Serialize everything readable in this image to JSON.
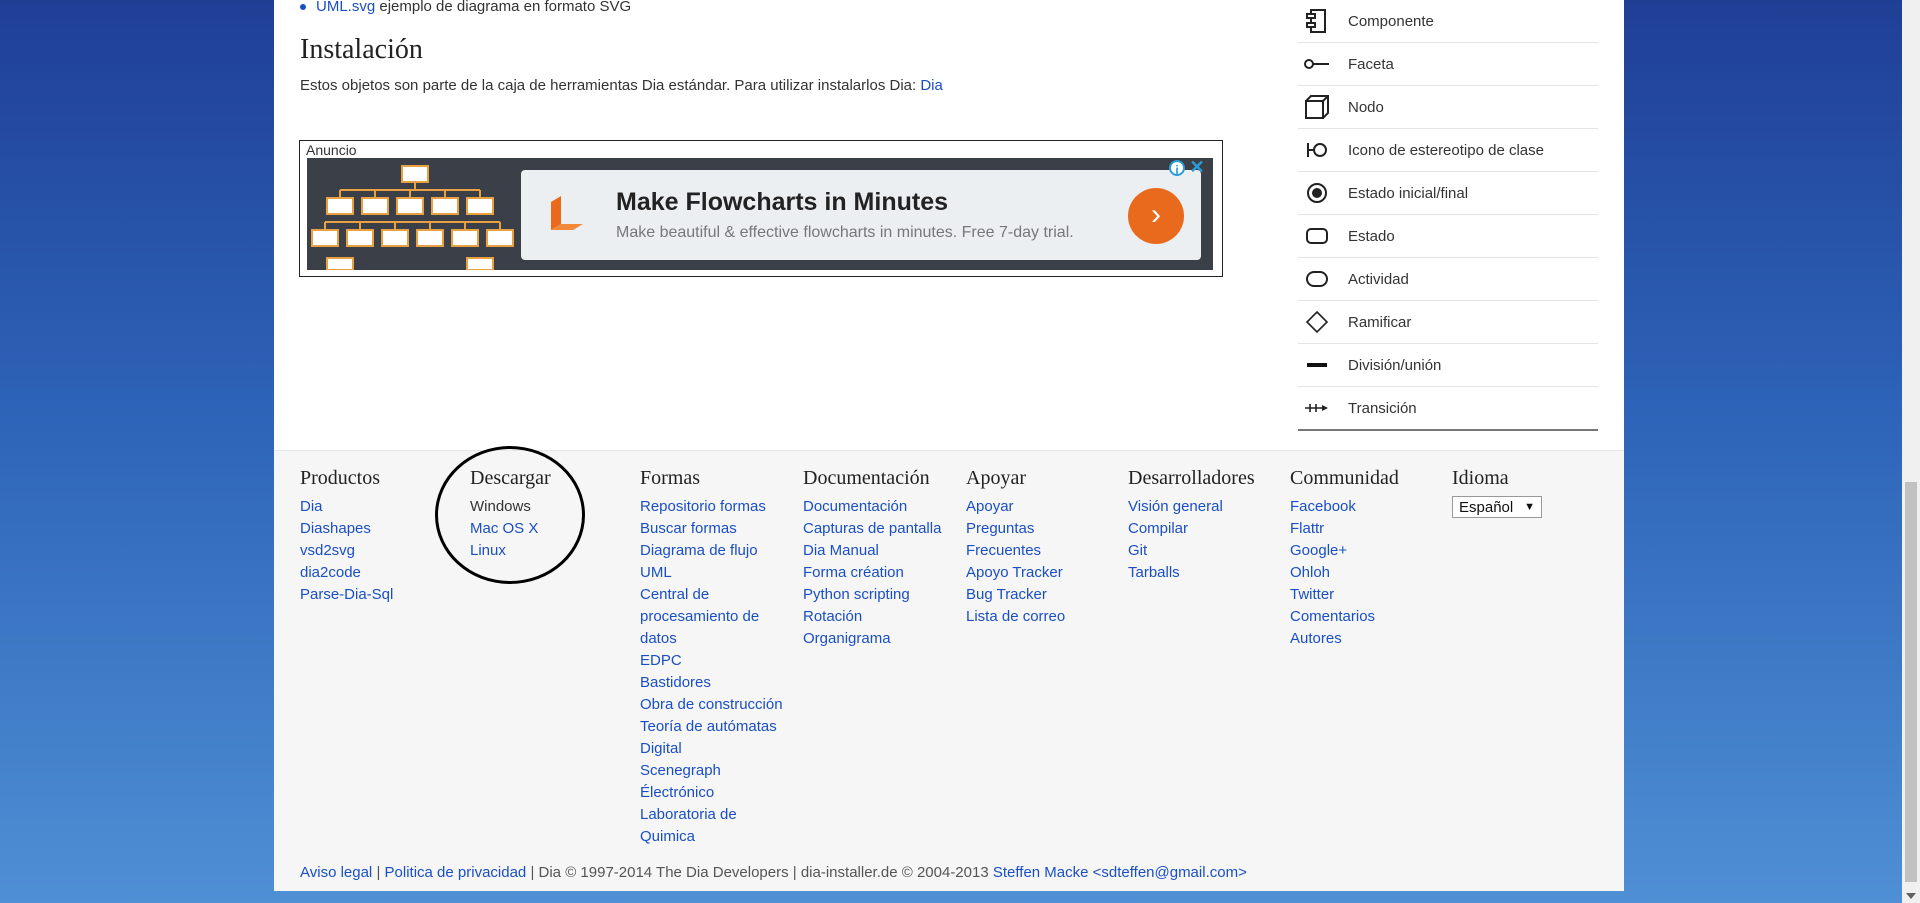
{
  "content": {
    "bullet": {
      "link": "UML.svg",
      "text": "ejemplo de diagrama en formato SVG"
    },
    "install_title": "Instalación",
    "install_text": "Estos objetos son parte de la caja de herramientas Dia estándar. Para utilizar instalarlos Dia:",
    "install_link": "Dia"
  },
  "ad": {
    "label": "Anuncio",
    "headline": "Make Flowcharts in Minutes",
    "subtext": "Make beautiful & effective flowcharts in minutes. Free 7-day trial.",
    "info_glyph": "i",
    "close_glyph": "✕",
    "go_glyph": "›",
    "accent_color": "#e96a1d"
  },
  "shapes": [
    {
      "label": "Componente",
      "icon": "component-icon"
    },
    {
      "label": "Faceta",
      "icon": "facet-icon"
    },
    {
      "label": "Nodo",
      "icon": "node-icon"
    },
    {
      "label": "Icono de estereotipo de clase",
      "icon": "class-stereotype-icon"
    },
    {
      "label": "Estado inicial/final",
      "icon": "initial-final-state-icon"
    },
    {
      "label": "Estado",
      "icon": "state-icon"
    },
    {
      "label": "Actividad",
      "icon": "activity-icon"
    },
    {
      "label": "Ramificar",
      "icon": "branch-icon"
    },
    {
      "label": "División/unión",
      "icon": "fork-join-icon"
    },
    {
      "label": "Transición",
      "icon": "transition-icon"
    }
  ],
  "footer": {
    "productos": {
      "title": "Productos",
      "items": [
        "Dia",
        "Diashapes",
        "vsd2svg",
        "dia2code",
        "Parse-Dia-Sql"
      ]
    },
    "descargar": {
      "title": "Descargar",
      "items": [
        "Windows",
        "Mac OS X",
        "Linux"
      ]
    },
    "formas": {
      "title": "Formas",
      "items": [
        "Repositorio formas",
        "Buscar formas",
        "Diagrama de flujo",
        "UML",
        "Central de",
        "procesamiento de",
        "datos",
        "EDPC",
        "Bastidores",
        "Obra de construcción",
        "Teoría de autómatas",
        "Digital",
        "Scenegraph",
        "Électrónico",
        "Laboratoria de",
        "Quimica"
      ]
    },
    "documentacion": {
      "title": "Documentación",
      "items": [
        "Documentación",
        "Capturas de pantalla",
        "Dia Manual",
        "Forma création",
        "Python scripting",
        "Rotación",
        "Organigrama"
      ]
    },
    "apoyar": {
      "title": "Apoyar",
      "items": [
        "Apoyar",
        "Preguntas",
        "Frecuentes",
        "Apoyo Tracker",
        "Bug Tracker",
        "Lista de correo"
      ]
    },
    "desarrolladores": {
      "title": "Desarrolladores",
      "items": [
        "Visión general",
        "Compilar",
        "Git",
        "Tarballs"
      ]
    },
    "comunidad": {
      "title": "Communidad",
      "items": [
        "Facebook",
        "Flattr",
        "Google+",
        "Ohloh",
        "Twitter",
        "Comentarios",
        "Autores"
      ]
    },
    "idioma": {
      "title": "Idioma",
      "selected": "Español",
      "arrow": "▼"
    }
  },
  "bottom": {
    "aviso": "Aviso legal",
    "sep": "|",
    "privacidad": "Politica de privacidad",
    "copyright": "| Dia © 1997-2014 The Dia Developers | dia-installer.de © 2004-2013",
    "author": "Steffen Macke <sdteffen@gmail.com>"
  }
}
